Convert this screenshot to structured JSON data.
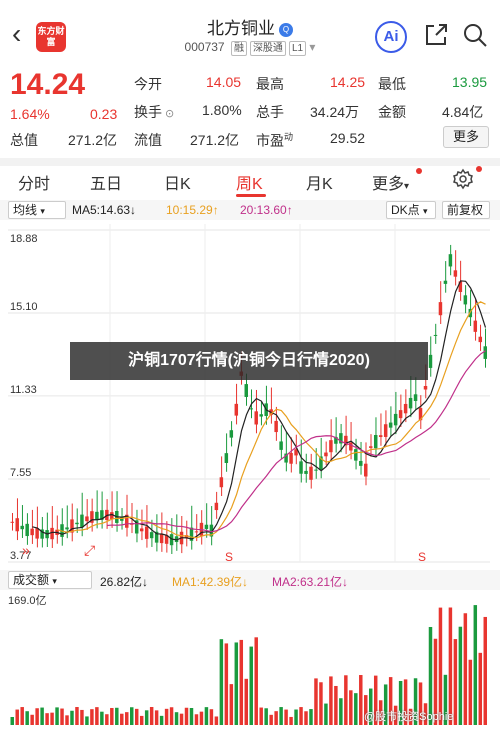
{
  "header": {
    "back_glyph": "‹",
    "logo_text": "东方财富",
    "title": "北方铜业",
    "title_badge": "Q",
    "code": "000737",
    "tags": [
      "融",
      "深股通",
      "L1"
    ],
    "ai_label": "Ai"
  },
  "quote": {
    "price": "14.24",
    "change_pct": "1.64%",
    "change_amt": "0.23",
    "open_label": "今开",
    "open": "14.05",
    "high_label": "最高",
    "high": "14.25",
    "low_label": "最低",
    "low": "13.95",
    "turnover_label": "换手",
    "turnover": "1.80%",
    "volume_label": "总手",
    "volume": "34.24万",
    "amount_label": "金额",
    "amount": "4.84亿",
    "mktcap_label": "总值",
    "mktcap": "271.2亿",
    "float_label": "流值",
    "float_cap": "271.2亿",
    "pe_label": "市盈",
    "pe_super": "动",
    "pe": "29.52",
    "more_label": "更多"
  },
  "tabs": [
    "分时",
    "五日",
    "日K",
    "周K",
    "月K",
    "更多"
  ],
  "active_tab": "周K",
  "ma": {
    "selector": "均线",
    "ma5": "MA5:14.63",
    "ma10": "10:15.29",
    "ma20": "20:13.60",
    "dk": "DK点",
    "fq": "前复权",
    "colors": {
      "ma5": "#222222",
      "ma10": "#e8a020",
      "ma20": "#c0308a"
    }
  },
  "overlay_text": "沪铜1707行情(沪铜今日行情2020)",
  "chart_data": {
    "type": "candlestick",
    "y_ticks": [
      "18.88",
      "15.10",
      "11.33",
      "7.55",
      "3.77"
    ],
    "ylim": [
      3.77,
      18.88
    ],
    "markers": [
      "S",
      "S"
    ],
    "volume": {
      "selector": "成交额",
      "value": "26.82亿",
      "ma1": "MA1:42.39亿",
      "ma2": "MA2:63.21亿",
      "top_label": "169.0亿"
    }
  },
  "watermark": "@股市投资Sophie"
}
